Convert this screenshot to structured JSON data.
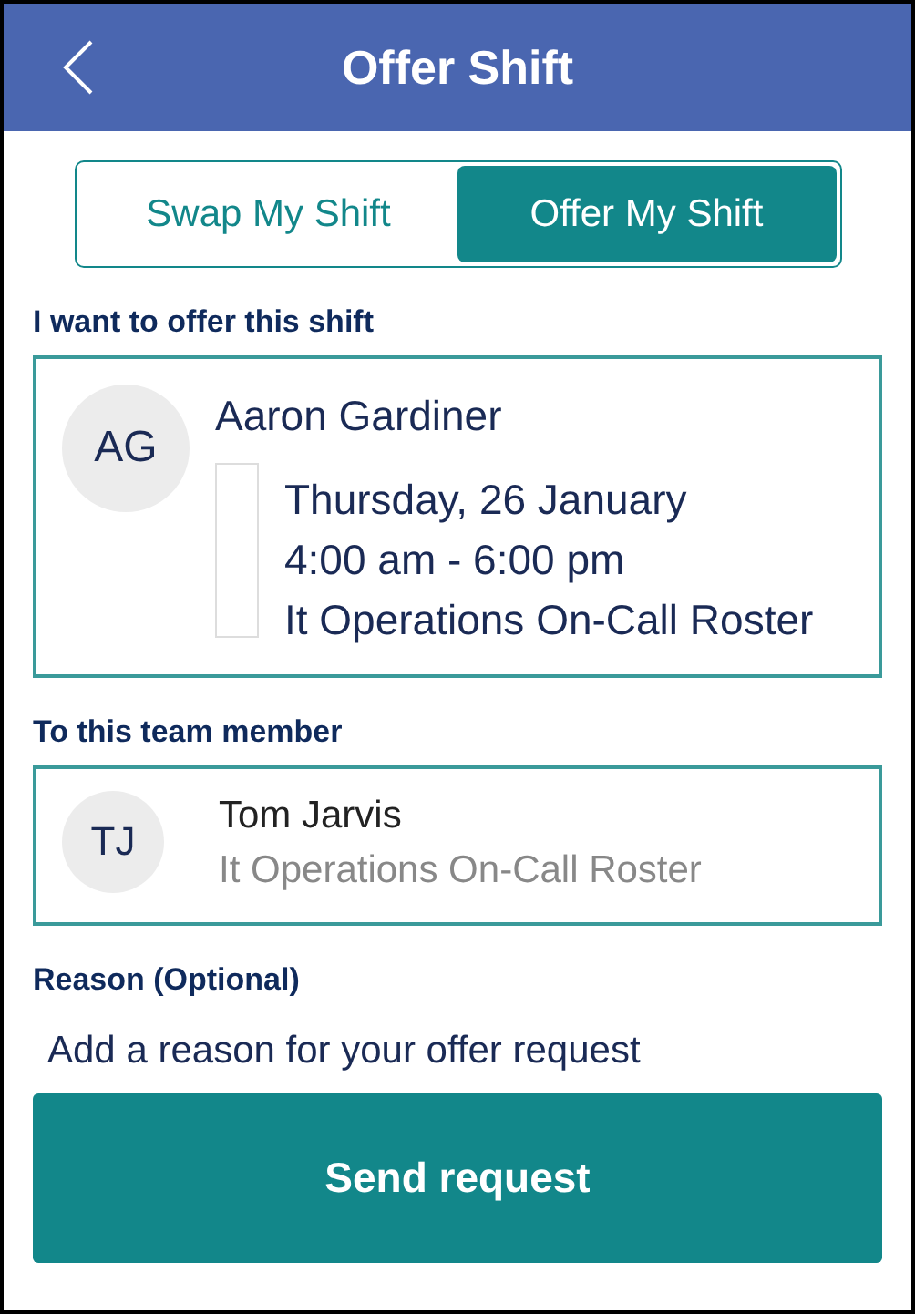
{
  "header": {
    "title": "Offer Shift"
  },
  "tabs": [
    {
      "label": "Swap My Shift",
      "selected": false
    },
    {
      "label": "Offer My Shift",
      "selected": true
    }
  ],
  "offer_section": {
    "label": "I want to offer this shift",
    "person": {
      "initials": "AG",
      "name": "Aaron Gardiner"
    },
    "shift": {
      "date": "Thursday, 26 January",
      "time": "4:00 am - 6:00 pm",
      "roster": "It Operations On-Call Roster"
    }
  },
  "recipient_section": {
    "label": "To this team member",
    "person": {
      "initials": "TJ",
      "name": "Tom Jarvis",
      "roster": "It Operations On-Call Roster"
    }
  },
  "reason": {
    "label": "Reason (Optional)",
    "placeholder": "Add a reason for your offer request"
  },
  "button": {
    "label": "Send request"
  }
}
